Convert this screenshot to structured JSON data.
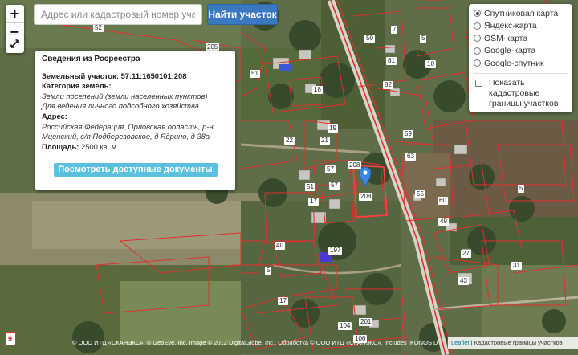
{
  "search": {
    "placeholder": "Адрес или кадастровый номер участка",
    "button_label": "Найти участок"
  },
  "zoom": {
    "in_label": "+",
    "out_label": "−"
  },
  "info": {
    "title": "Сведения из Росреестра",
    "parcel_label": "Земельный участок:",
    "parcel_number": "57:11:1650101:208",
    "category_label": "Категория земель:",
    "category_value": "Земли поселений (земли населенных пунктов)",
    "usage_value": "Для ведения личного подсобного хозяйства",
    "address_label": "Адрес:",
    "address_line1": "Российская Федерация, Орловская область, р-н",
    "address_line2": "Мценский, с/п Подберезовское, д Ядрино, д 38а",
    "area_label": "Площадь:",
    "area_value": "2500 кв. м.",
    "docs_button": "Посмотреть доступные документы"
  },
  "layers": {
    "options": [
      {
        "label": "Спутниковая карта",
        "selected": true
      },
      {
        "label": "Яндекс-карта",
        "selected": false
      },
      {
        "label": "OSM-карта",
        "selected": false
      },
      {
        "label": "Google-карта",
        "selected": false
      },
      {
        "label": "Google-спутник",
        "selected": false
      }
    ],
    "checkbox_label_1": "Показать",
    "checkbox_label_2": "кадастровые",
    "checkbox_label_3": "границы участков",
    "checkbox_checked": false
  },
  "map": {
    "selected_parcel": "208",
    "labels": [
      "52",
      "205",
      "50",
      "81",
      "82",
      "18",
      "51",
      "5",
      "7",
      "10",
      "19",
      "59",
      "22",
      "21",
      "63",
      "57",
      "208",
      "208",
      "51",
      "57",
      "17",
      "55",
      "60",
      "5",
      "49",
      "40",
      "197",
      "27",
      "31",
      "43",
      "17",
      "201",
      "5",
      "104",
      "106"
    ],
    "marker_icon": "map-pin-icon"
  },
  "attribution": {
    "imagery": "© ООО ИТЦ «СКАНЭКС», © GeoEye, Inc, Image © 2012 DigitalGlobe, Inc., Обработка © ООО ИТЦ «СКАНЭКС», Includes IKONOS Data",
    "leaflet": "Leaflet",
    "separator": "|",
    "cadastral": "Кадастровые границы участков"
  },
  "colors": {
    "boundary": "#e03030",
    "road": "#d8d4c6",
    "marker": "#3b87e6",
    "button": "#3a78c2",
    "docs_button": "#5bc0de"
  }
}
